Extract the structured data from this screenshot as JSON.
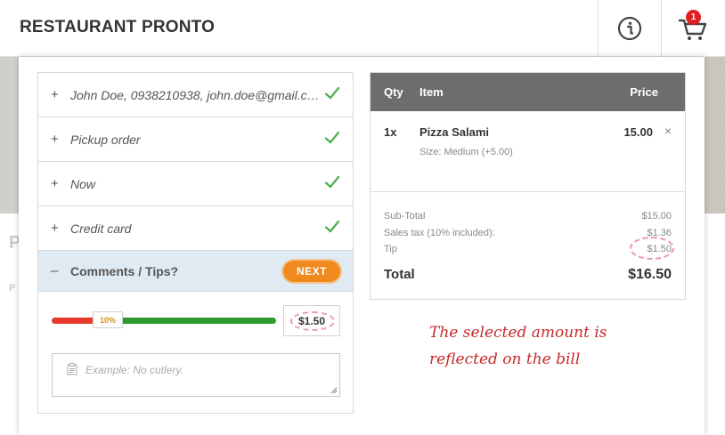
{
  "app": {
    "title": "RESTAURANT PRONTO",
    "cart_count": "1"
  },
  "header": {
    "info_icon": "info-circle-icon",
    "cart_icon": "shopping-cart-icon"
  },
  "steps": [
    {
      "label": "John Doe, 0938210938, john.doe@gmail.com",
      "done": true
    },
    {
      "label": "Pickup order",
      "done": true
    },
    {
      "label": "Now",
      "done": true
    },
    {
      "label": "Credit card",
      "done": true
    }
  ],
  "active_step": {
    "label": "Comments / Tips?",
    "next_label": "NEXT",
    "expand_symbol": "–"
  },
  "tip": {
    "percent_label": "10%",
    "percent": 10,
    "amount": "$1.50"
  },
  "comment": {
    "placeholder": "Example: No cutlery."
  },
  "order": {
    "headers": {
      "qty": "Qty",
      "item": "Item",
      "price": "Price"
    },
    "items": [
      {
        "qty": "1x",
        "name": "Pizza Salami",
        "size": "Size: Medium (+5.00)",
        "price": "15.00",
        "remove": "×"
      }
    ],
    "subtotal_label": "Sub-Total",
    "subtotal": "$15.00",
    "tax_label": "Sales tax (10% included):",
    "tax": "$1.36",
    "tip_label": "Tip",
    "tip": "$1.50",
    "total_label": "Total",
    "total": "$16.50"
  },
  "annotation": {
    "line1": "The selected amount is",
    "line2": "reflected on the bill"
  },
  "colors": {
    "accent_orange": "#f08a1e",
    "check_green": "#4cae4c",
    "slider_red": "#e53a2b",
    "slider_green": "#2e9a2e",
    "annotation_red": "#c62a2a",
    "order_header": "#6d6d6d"
  }
}
